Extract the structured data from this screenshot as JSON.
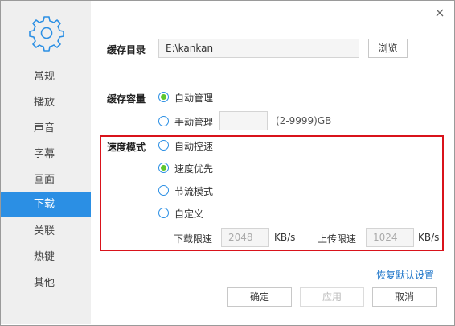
{
  "window": {
    "close_icon": "close-icon"
  },
  "sidebar": {
    "icon": "gear-icon",
    "items": [
      {
        "label": "常规",
        "active": false
      },
      {
        "label": "播放",
        "active": false
      },
      {
        "label": "声音",
        "active": false
      },
      {
        "label": "字幕",
        "active": false
      },
      {
        "label": "画面",
        "active": false
      },
      {
        "label": "下载",
        "active": true
      },
      {
        "label": "关联",
        "active": false
      },
      {
        "label": "热键",
        "active": false
      },
      {
        "label": "其他",
        "active": false
      }
    ]
  },
  "cache_dir": {
    "label": "缓存目录",
    "value": "E:\\kankan",
    "browse": "浏览"
  },
  "cache_capacity": {
    "label": "缓存容量",
    "auto": "自动管理",
    "manual": "手动管理",
    "manual_value": "",
    "range": "(2-9999)GB",
    "selected": "auto"
  },
  "speed_mode": {
    "label": "速度模式",
    "options": [
      "自动控速",
      "速度优先",
      "节流模式",
      "自定义"
    ],
    "selected": 1,
    "download_limit_label": "下载限速",
    "download_limit_value": "2048",
    "upload_limit_label": "上传限速",
    "upload_limit_value": "1024",
    "unit": "KB/s"
  },
  "restore_defaults": "恢复默认设置",
  "footer": {
    "ok": "确定",
    "apply": "应用",
    "cancel": "取消"
  },
  "colors": {
    "accent": "#2b8fe4",
    "radio_checked": "#5fc62d",
    "highlight": "#d9131b"
  }
}
